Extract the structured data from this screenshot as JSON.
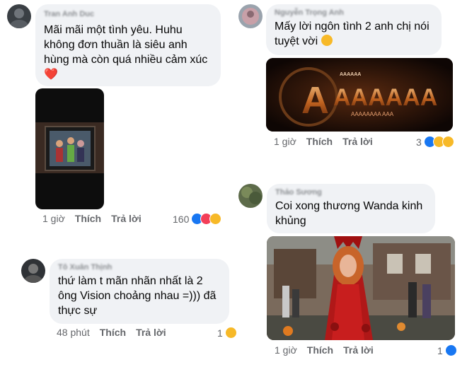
{
  "comments": [
    {
      "author": "Tran Anh Duc",
      "text": "Mãi mãi một tình yêu. Huhu không đơn thuần là siêu anh hùng mà còn quá nhiều cảm xúc",
      "emoji": "❤️",
      "time": "1 giờ",
      "like_label": "Thích",
      "reply_label": "Trả lời",
      "reaction_count": "160",
      "reactions": [
        "like-icon",
        "love-icon",
        "sad-icon"
      ]
    },
    {
      "author": "Nguyễn Trọng Anh",
      "text": "Mấy lời ngôn tình 2 anh chị nói tuyệt vời",
      "time": "1 giờ",
      "like_label": "Thích",
      "reply_label": "Trả lời",
      "reaction_count": "3",
      "reactions": [
        "like-icon",
        "haha-icon",
        "sad-icon"
      ],
      "gif_big_text": "AAAAAA",
      "gif_small_top": "AAAAAA",
      "gif_small_bottom": "AAAAAAAA  AAA"
    },
    {
      "author": "Thảo Sương",
      "text": "Coi xong thương Wanda kinh khủng",
      "time": "1 giờ",
      "like_label": "Thích",
      "reply_label": "Trả lời",
      "reaction_count": "1",
      "reactions": [
        "like-icon"
      ]
    },
    {
      "author": "Tô Xuân Thịnh",
      "text": "thứ làm t mãn nhãn nhất là 2 ông Vision choảng nhau =))) đã thực sự",
      "time": "48 phút",
      "like_label": "Thích",
      "reply_label": "Trả lời",
      "reaction_count": "1",
      "reactions": [
        "haha-icon"
      ]
    }
  ],
  "colors": {
    "bubble": "#f0f2f5",
    "meta": "#65676b",
    "like": "#1877f2",
    "love": "#f33e58",
    "haha": "#f7b928"
  }
}
